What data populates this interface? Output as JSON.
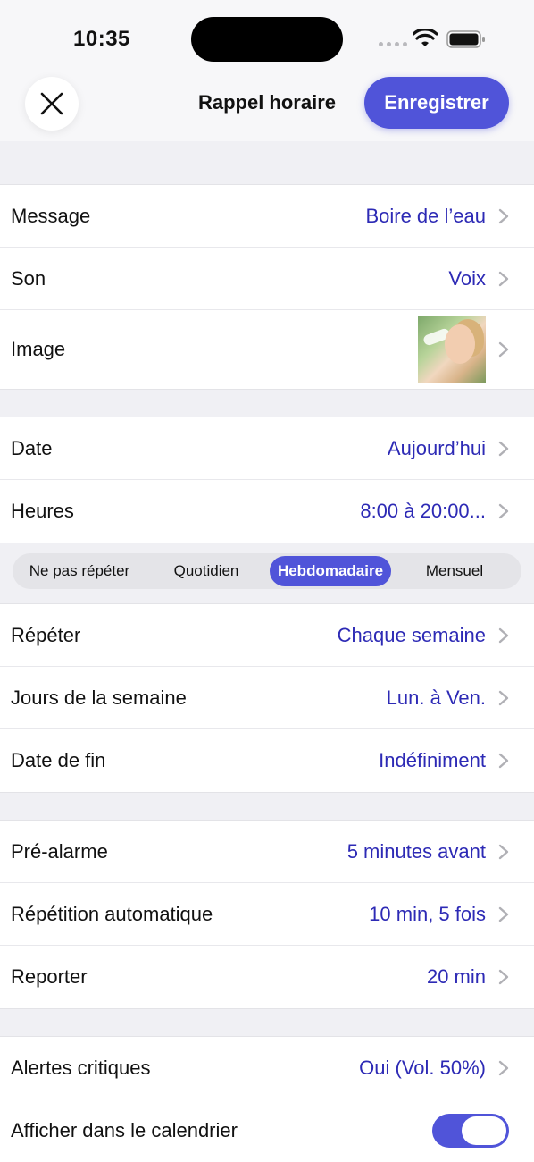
{
  "status_bar": {
    "time": "10:35"
  },
  "nav": {
    "title": "Rappel horaire",
    "save_label": "Enregistrer"
  },
  "group1": [
    {
      "label": "Message",
      "value": "Boire de l’eau"
    },
    {
      "label": "Son",
      "value": "Voix"
    },
    {
      "label": "Image",
      "value": ""
    }
  ],
  "group2": [
    {
      "label": "Date",
      "value": "Aujourd’hui"
    },
    {
      "label": "Heures",
      "value": "8:00 à 20:00..."
    }
  ],
  "segments": {
    "items": [
      "Ne pas répéter",
      "Quotidien",
      "Hebdomadaire",
      "Mensuel"
    ],
    "selected": "Hebdomadaire"
  },
  "group3": [
    {
      "label": "Répéter",
      "value": "Chaque semaine"
    },
    {
      "label": "Jours de la semaine",
      "value": "Lun. à Ven."
    },
    {
      "label": "Date de fin",
      "value": "Indéfiniment"
    }
  ],
  "group4": [
    {
      "label": "Pré-alarme",
      "value": "5 minutes avant"
    },
    {
      "label": "Répétition automatique",
      "value": "10 min, 5 fois"
    },
    {
      "label": "Reporter",
      "value": "20 min"
    }
  ],
  "group5": [
    {
      "label": "Alertes critiques",
      "value": "Oui (Vol. 50%)"
    },
    {
      "label": "Afficher dans le calendrier",
      "toggle_on": true
    }
  ],
  "colors": {
    "accent": "#5054d9",
    "value_text": "#2d2ab5",
    "background": "#f2f2f6"
  }
}
